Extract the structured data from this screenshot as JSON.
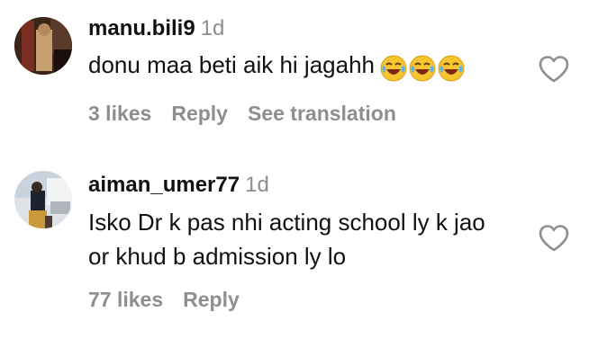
{
  "comments": [
    {
      "username": "manu.bili9",
      "time": "1d",
      "text": "donu maa beti aik hi jagahh",
      "emojis": [
        "face-with-tears-of-joy",
        "face-with-tears-of-joy",
        "face-with-tears-of-joy"
      ],
      "likes": "3 likes",
      "reply": "Reply",
      "translate": "See translation",
      "heart_icon": "heart-outline-icon"
    },
    {
      "username": "aiman_umer77",
      "time": "1d",
      "text_line1": "Isko Dr k pas nhi acting school ly k jao",
      "text_line2": "or khud b admission ly lo",
      "likes": "77 likes",
      "reply": "Reply",
      "heart_icon": "heart-outline-icon"
    }
  ],
  "colors": {
    "text": "#111111",
    "secondary": "#8e8e8e",
    "background": "#ffffff"
  }
}
